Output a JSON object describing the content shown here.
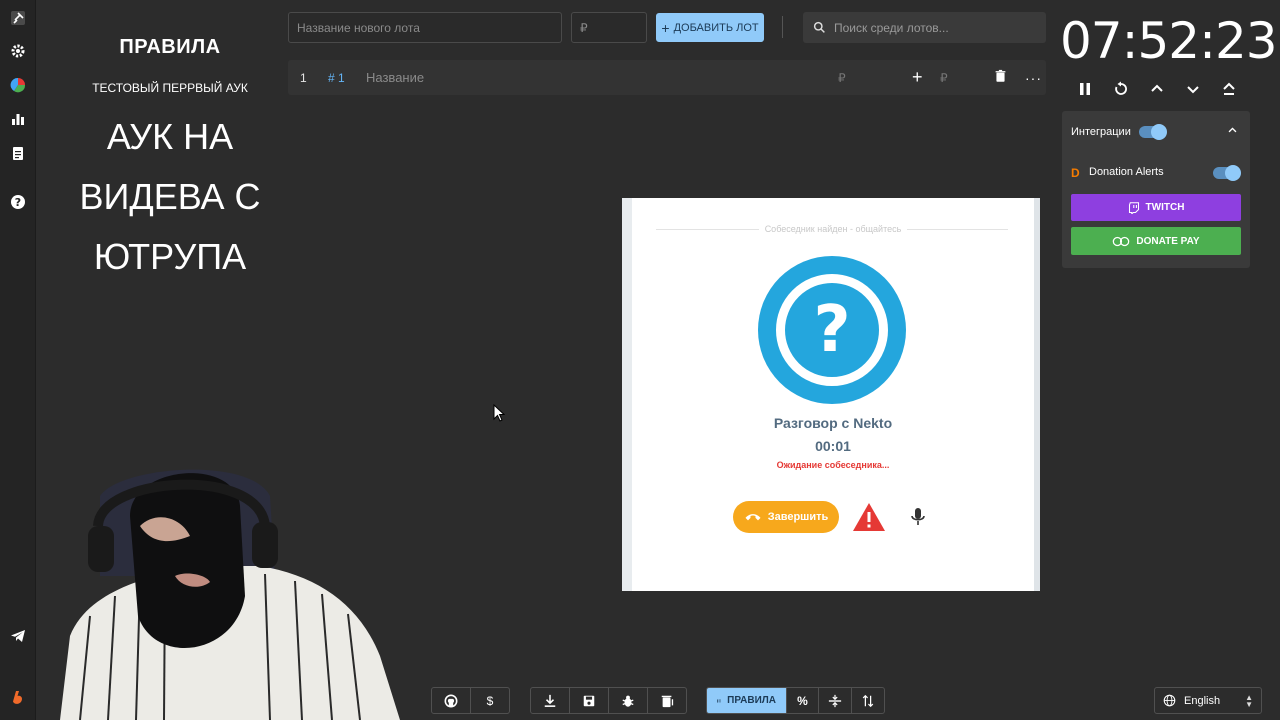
{
  "rules": {
    "title": "ПРАВИЛА",
    "subtitle": "ТЕСТОВЫЙ ПЕРРВЫЙ АУК",
    "lines": [
      "АУК НА",
      "ВИДЕВА С",
      "ЮТРУПА"
    ]
  },
  "topbar": {
    "lot_name_placeholder": "Название нового лота",
    "amount_placeholder": "₽",
    "add_lot_label": "ДОБАВИТЬ ЛОТ",
    "search_placeholder": "Поиск среди лотов..."
  },
  "lot": {
    "index": "1",
    "id": "# 1",
    "title_placeholder": "Название",
    "currency": "₽",
    "currency_add": "₽"
  },
  "timer": {
    "value": "07:52:23"
  },
  "integrations": {
    "label": "Интеграции",
    "donation_alerts": "Donation Alerts",
    "twitch": "TWITCH",
    "donatepay": "DONATE PAY"
  },
  "video": {
    "status": "Собеседник найден - общайтесь",
    "conv_title": "Разговор с Nekto",
    "conv_timer": "00:01",
    "waiting": "Ожидание собеседника...",
    "end_label": "Завершить"
  },
  "toolbar": {
    "rules_label": "ПРАВИЛА",
    "dollar": "$",
    "percent": "%"
  },
  "language": {
    "selected": "English"
  },
  "colors": {
    "accent": "#90caf9",
    "twitch": "#8e3fe0",
    "donatepay": "#4caf50",
    "nekto_blue": "#24a6dd",
    "end_call": "#f7a81c",
    "warning": "#e53935"
  }
}
